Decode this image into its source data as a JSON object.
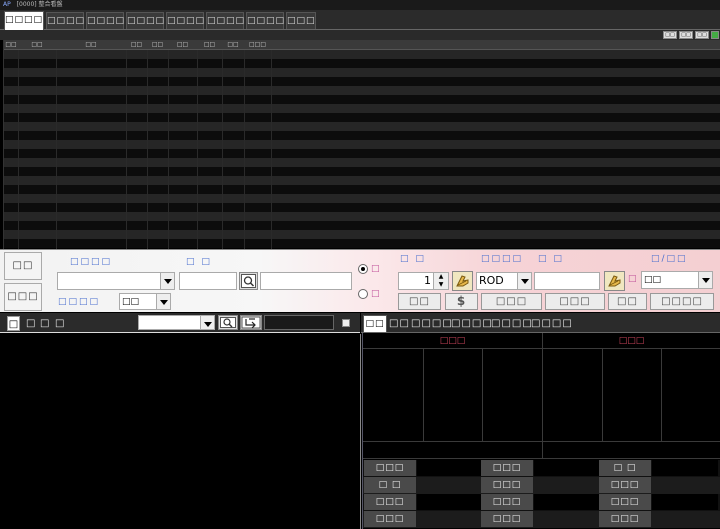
{
  "window": {
    "title": "[0000] 整合看盤",
    "logo": "AP"
  },
  "top_tabs": [
    "□□□□",
    "□□□□",
    "□□□□",
    "□□□□",
    "□□□□",
    "□□□□",
    "□□□□",
    "□□□"
  ],
  "grid_toolbar": {
    "buttons": [
      "□□",
      "□□",
      "□□"
    ]
  },
  "grid": {
    "headers": [
      "□□",
      "□□",
      "□□",
      "□□",
      "□□",
      "□□",
      "□□",
      "□□",
      "□□□"
    ],
    "row_count": 22
  },
  "order_panel": {
    "side_buttons": [
      "□□",
      "□□□"
    ],
    "labels": {
      "account": "□□□□",
      "stock": "□ □",
      "type": "□□□□",
      "qty": "□ □",
      "price_type": "□□□□",
      "price": "□ □",
      "cond": "□/□□"
    },
    "type_value": "□□",
    "qty_value": "1",
    "price_type_value": "ROD",
    "cond_value": "□□",
    "radio_labels": [
      "□",
      "□"
    ],
    "small_label": "□",
    "action_buttons": [
      "□□",
      "$",
      "□□□",
      "□□□",
      "□□",
      "□□□□"
    ]
  },
  "lower_left": {
    "tabs": [
      "□",
      "□",
      "□",
      "□"
    ]
  },
  "lower_right": {
    "tabs": [
      "□□",
      "□□",
      "□□□□",
      "□□□□",
      "□□□□",
      "□□□□"
    ],
    "quote_headers": [
      "□□□",
      "□□□"
    ],
    "detail_labels": [
      [
        "□□□",
        "□□□",
        "□ □"
      ],
      [
        "□ □",
        "□□□",
        "□□□"
      ],
      [
        "□□□",
        "□□□",
        "□□□"
      ],
      [
        "□□□",
        "□□□",
        "□□□"
      ]
    ]
  },
  "colors": {
    "accent_blue": "#4a6fcf",
    "pink": "#c0509a",
    "red": "#c8445a"
  }
}
